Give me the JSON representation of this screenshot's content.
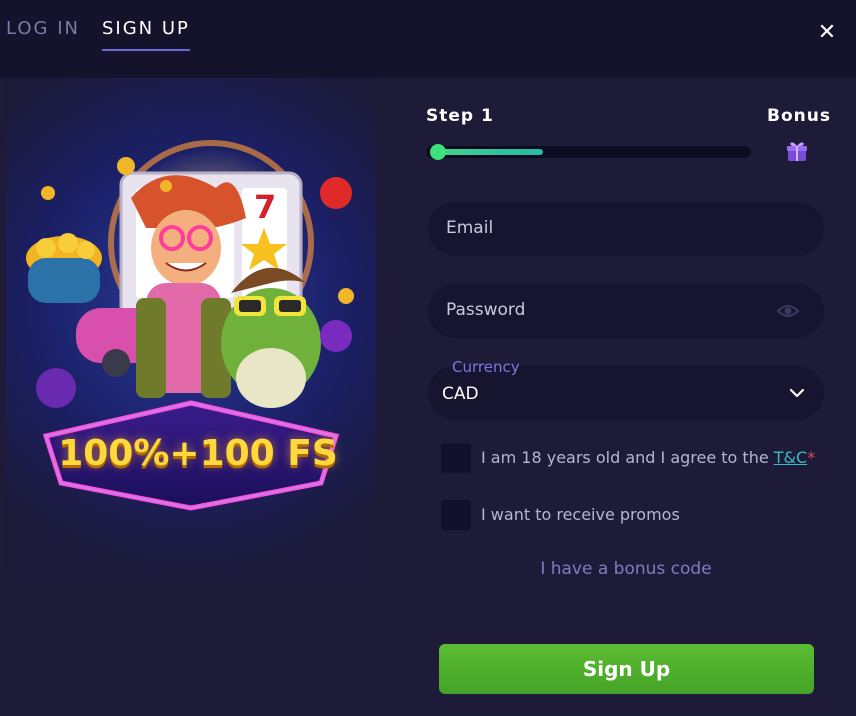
{
  "tabs": {
    "login": "LOG IN",
    "signup": "SIGN UP"
  },
  "close_icon": "close-icon",
  "promo": {
    "headline": "100%+100 FS",
    "slot_number": "7"
  },
  "steps": {
    "current": "Step 1",
    "next": "Bonus",
    "progress": 0.35
  },
  "form": {
    "email_placeholder": "Email",
    "password_placeholder": "Password",
    "currency_label": "Currency",
    "currency_value": "CAD",
    "age_text": "I am 18 years old and I agree to the ",
    "tc_link": "T&C",
    "tc_asterisk": "*",
    "promos_text": "I want to receive promos",
    "bonus_code_link": "I have a bonus code",
    "submit_label": "Sign Up"
  },
  "colors": {
    "background": "#1e1b38",
    "accent": "#6a6ad8",
    "progress": "#3fd28a",
    "button": "#4caf2c",
    "link": "#3cb9c7"
  }
}
